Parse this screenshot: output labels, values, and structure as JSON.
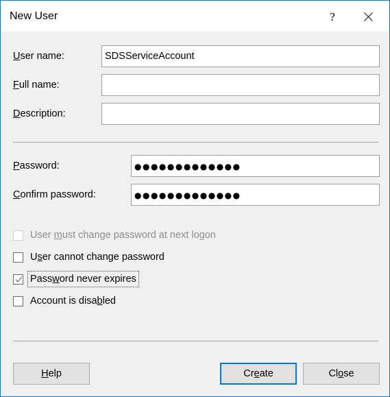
{
  "window": {
    "title": "New User",
    "accent_color": "#0078d7",
    "client_background": "#f0f0f0",
    "titlebar_background": "#ffffff"
  },
  "caption_buttons": [
    {
      "name": "help",
      "glyph": "?",
      "tooltip": "Help"
    },
    {
      "name": "close",
      "glyph": "✕",
      "tooltip": "Close"
    }
  ],
  "fields": [
    {
      "label_pre": "",
      "label_key": "U",
      "label_post": "ser name:",
      "value": "SDSServiceAccount",
      "placeholder": "",
      "masked": false,
      "disabled": false
    },
    {
      "label_pre": "",
      "label_key": "F",
      "label_post": "ull name:",
      "value": "",
      "placeholder": "",
      "masked": false,
      "disabled": false
    },
    {
      "label_pre": "",
      "label_key": "D",
      "label_post": "escription:",
      "value": "",
      "placeholder": "",
      "masked": false,
      "disabled": false
    },
    {
      "label_pre": "",
      "label_key": "P",
      "label_post": "assword:",
      "value": "●●●●●●●●●●●●●",
      "placeholder": "",
      "masked": true,
      "disabled": false
    },
    {
      "label_pre": "",
      "label_key": "C",
      "label_post": "onfirm password:",
      "value": "●●●●●●●●●●●●●",
      "placeholder": "",
      "masked": true,
      "disabled": false
    }
  ],
  "checkboxes": [
    {
      "label_pre": "User ",
      "label_key": "m",
      "label_post": "ust change password at next logon",
      "checked": false,
      "disabled": true,
      "focused": false
    },
    {
      "label_pre": "U",
      "label_key": "s",
      "label_post": "er cannot change password",
      "checked": false,
      "disabled": false,
      "focused": false
    },
    {
      "label_pre": "Pass",
      "label_key": "w",
      "label_post": "ord never expires",
      "checked": true,
      "disabled": false,
      "focused": true
    },
    {
      "label_pre": "Account is disa",
      "label_key": "b",
      "label_post": "led",
      "checked": false,
      "disabled": false,
      "focused": false
    }
  ],
  "buttons": [
    {
      "name": "help",
      "label_pre": "",
      "label_key": "H",
      "label_post": "elp",
      "default": false
    },
    {
      "name": "create",
      "label_pre": "Cr",
      "label_key": "e",
      "label_post": "ate",
      "default": true
    },
    {
      "name": "close",
      "label_pre": "Cl",
      "label_key": "o",
      "label_post": "se",
      "default": false
    }
  ]
}
